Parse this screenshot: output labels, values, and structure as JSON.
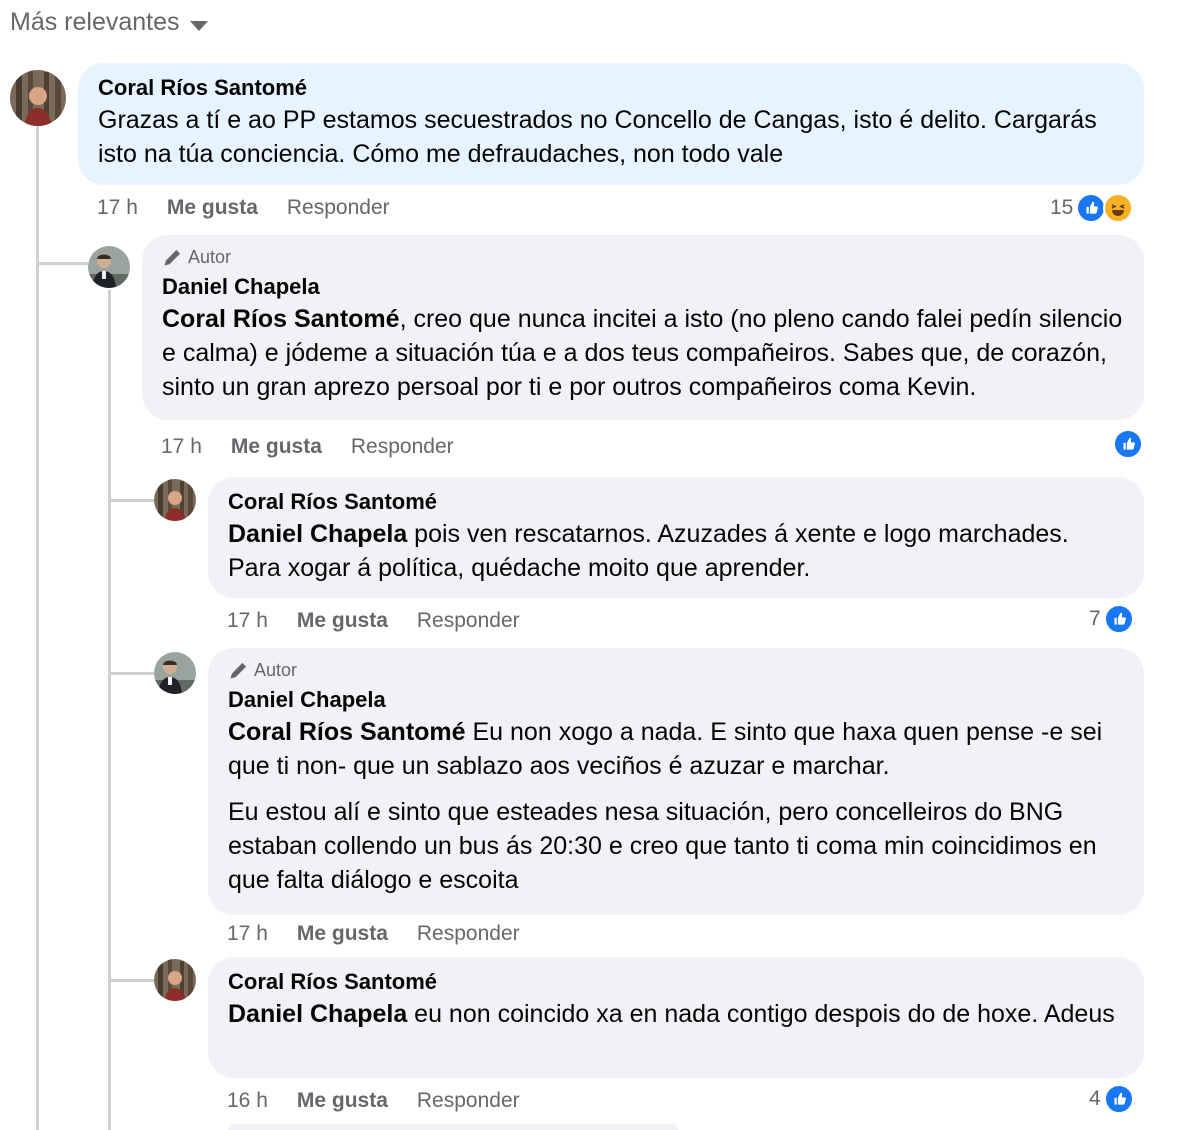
{
  "sort_label": "Más relevantes",
  "comments": [
    {
      "author": "Coral Ríos Santomé",
      "text": "Grazas a tí e ao PP estamos secuestrados no Concello de Cangas, isto é delito. Cargarás isto na túa conciencia. Cómo me defraudaches, non todo vale",
      "time": "17 h",
      "like_label": "Me gusta",
      "reply_label": "Responder",
      "reaction_count": "15",
      "reactions": [
        "like-icon",
        "haha-icon"
      ]
    },
    {
      "badge": "Autor",
      "author": "Daniel Chapela",
      "mention": "Coral Ríos Santomé",
      "text": ", creo que nunca incitei a isto (no pleno cando falei pedín silencio e calma) e jódeme a situación túa e a dos teus compañeiros. Sabes que, de corazón, sinto un gran aprezo persoal por ti e por outros compañeiros coma Kevin.",
      "time": "17 h",
      "like_label": "Me gusta",
      "reply_label": "Responder",
      "reaction_count": "",
      "reactions": [
        "like-icon"
      ]
    },
    {
      "author": "Coral Ríos Santomé",
      "mention": "Daniel Chapela",
      "text": " pois ven rescatarnos. Azuzades á xente e logo marchades. Para xogar á política, quédache moito que aprender.",
      "time": "17 h",
      "like_label": "Me gusta",
      "reply_label": "Responder",
      "reaction_count": "7",
      "reactions": [
        "like-icon"
      ]
    },
    {
      "badge": "Autor",
      "author": "Daniel Chapela",
      "mention": "Coral Ríos Santomé",
      "text": " Eu non xogo a nada. E sinto que haxa quen pense -e sei que ti non- que un sablazo aos veciños é azuzar e marchar.",
      "text2": "Eu estou alí e sinto que esteades nesa situación, pero concelleiros do BNG estaban collendo un bus ás 20:30 e creo que tanto ti coma min coincidimos en que falta diálogo e escoita",
      "time": "17 h",
      "like_label": "Me gusta",
      "reply_label": "Responder",
      "reaction_count": ""
    },
    {
      "author": "Coral Ríos Santomé",
      "mention": "Daniel Chapela",
      "text": " eu non coincido xa en nada contigo despois do de hoxe. Adeus",
      "time": "16 h",
      "like_label": "Me gusta",
      "reply_label": "Responder",
      "reaction_count": "4",
      "reactions": [
        "like-icon"
      ]
    }
  ]
}
